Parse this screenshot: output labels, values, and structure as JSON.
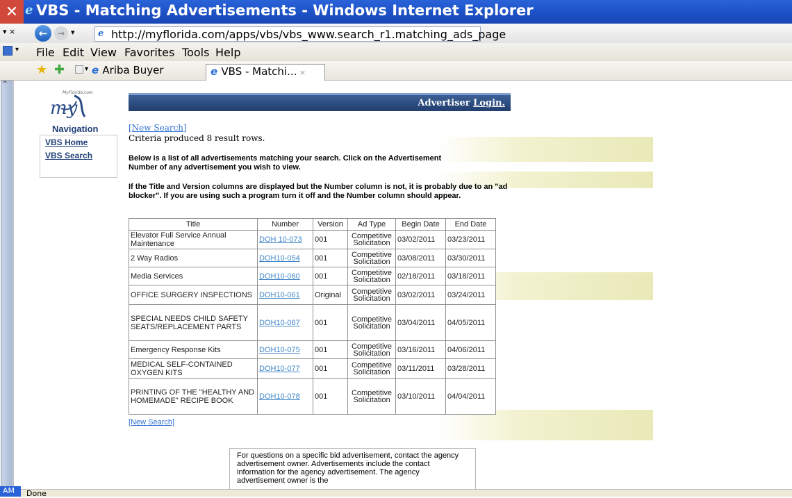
{
  "window": {
    "title": "VBS - Matching Advertisements - Windows Internet Explorer",
    "url": "http://myflorida.com/apps/vbs/vbs_www.search_r1.matching_ads_page"
  },
  "menu": {
    "items": [
      "File",
      "Edit",
      "View",
      "Favorites",
      "Tools",
      "Help"
    ]
  },
  "tabs": {
    "tab1": "Ariba Buyer",
    "tab2": "VBS - Matchi..."
  },
  "header": {
    "advertiser": "Advertiser",
    "login": "Login."
  },
  "logo": {
    "small_text": "MyFlorida.com",
    "text": "my"
  },
  "nav": {
    "title": "Navigation",
    "home": "VBS Home",
    "search": "VBS Search"
  },
  "main": {
    "new_search": "[New Search]",
    "criteria": "Criteria produced 8 result rows.",
    "intro": "Below is a list of all advertisements matching your search. Click on the Advertisement Number of any advertisement you wish to view.",
    "adblock": "If the Title and Version columns are displayed but the Number column is not, it is probably due to an \"ad blocker\". If you are using such a program turn it off and the Number column should appear.",
    "table": {
      "headers": [
        "Title",
        "Number",
        "Version",
        "Ad Type",
        "Begin Date",
        "End Date"
      ],
      "rows": [
        [
          "Elevator Full Service Annual Maintenance",
          "DOH 10-073",
          "001",
          "Competitive Solicitation",
          "03/02/2011",
          "03/23/2011"
        ],
        [
          "2 Way Radios",
          "DOH10-054",
          "001",
          "Competitive Solicitation",
          "03/08/2011",
          "03/30/2011"
        ],
        [
          "Media Services",
          "DOH10-060",
          "001",
          "Competitive Solicitation",
          "02/18/2011",
          "03/18/2011"
        ],
        [
          "OFFICE SURGERY INSPECTIONS",
          "DOH10-061",
          "Original",
          "Competitive Solicitation",
          "03/02/2011",
          "03/24/2011"
        ],
        [
          "SPECIAL NEEDS CHILD SAFETY SEATS/REPLACEMENT PARTS",
          "DOH10-067",
          "001",
          "Competitive Solicitation",
          "03/04/2011",
          "04/05/2011"
        ],
        [
          "Emergency Response Kits",
          "DOH10-075",
          "001",
          "Competitive Solicitation",
          "03/16/2011",
          "04/06/2011"
        ],
        [
          "MEDICAL SELF-CONTAINED OXYGEN KITS",
          "DOH10-077",
          "001",
          "Competitive Solicitation",
          "03/11/2011",
          "03/28/2011"
        ],
        [
          "PRINTING OF THE \"HEALTHY AND HOMEMADE\" RECIPE BOOK",
          "DOH10-078",
          "001",
          "Competitive Solicitation",
          "03/10/2011",
          "04/04/2011"
        ]
      ]
    },
    "footer": "For questions on a specific bid advertisement, contact the agency advertisement owner. Advertisements include the contact information for the agency advertisement. The agency advertisement owner is the"
  },
  "status": {
    "text": "Done",
    "clock": "AM"
  },
  "colors": {
    "titlebar": "#1c4fc4",
    "header": "#213e6e",
    "link": "#3f86c8"
  }
}
